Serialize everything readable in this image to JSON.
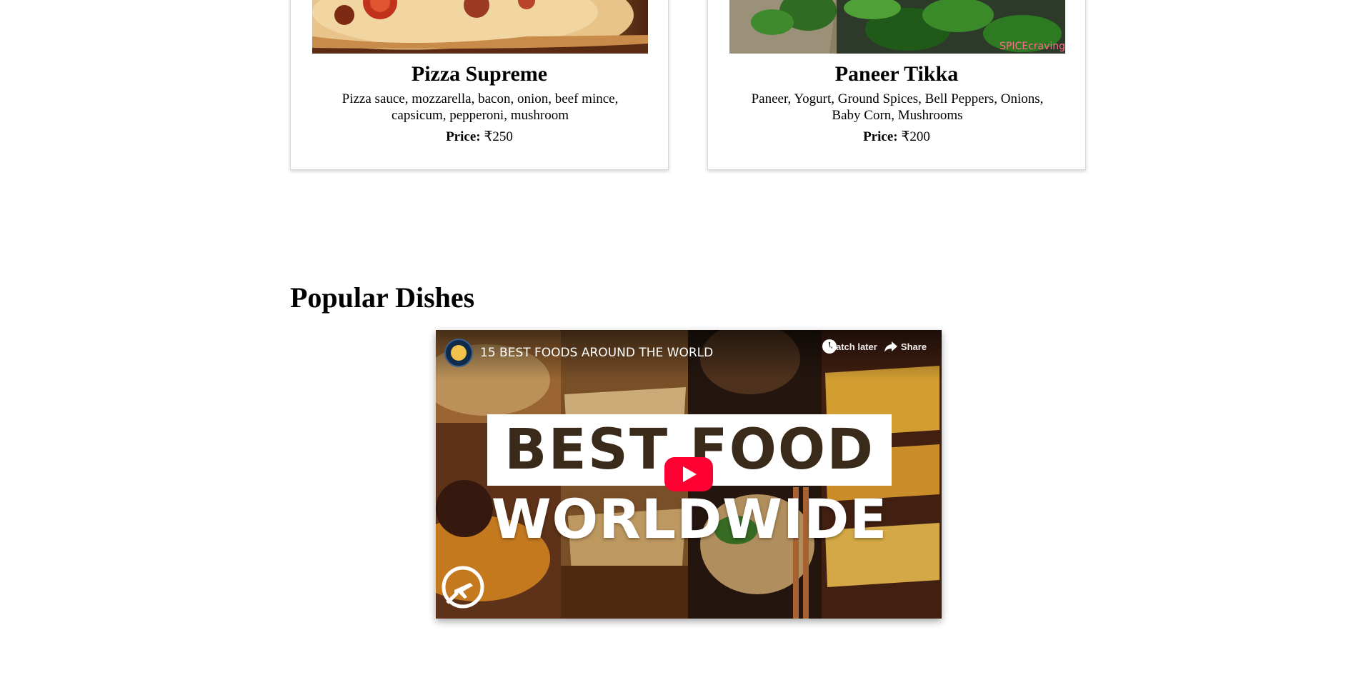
{
  "menu_cards": [
    {
      "title": "Pizza Supreme",
      "description": "Pizza sauce, mozzarella, bacon, onion, beef mince, capsicum, pepperoni, mushroom",
      "price_label": "Price:",
      "price_value": "₹250"
    },
    {
      "title": "Paneer Tikka",
      "description": "Paneer, Yogurt, Ground Spices, Bell Peppers, Onions, Baby Corn, Mushrooms",
      "price_label": "Price:",
      "price_value": "₹200",
      "image_watermark": "SPICEcravings"
    }
  ],
  "popular": {
    "heading": "Popular Dishes",
    "video": {
      "title": "15 BEST FOODS AROUND THE WORLD",
      "watch_later_label": "Watch later",
      "share_label": "Share",
      "thumbnail_line1": "BEST FOOD",
      "thumbnail_line2": "WORLDWIDE",
      "icons": [
        "channel-avatar",
        "clock-icon",
        "share-arrow-icon",
        "youtube-play-icon",
        "airplane-logo-icon"
      ],
      "play_button_color": "#ff0033"
    }
  }
}
